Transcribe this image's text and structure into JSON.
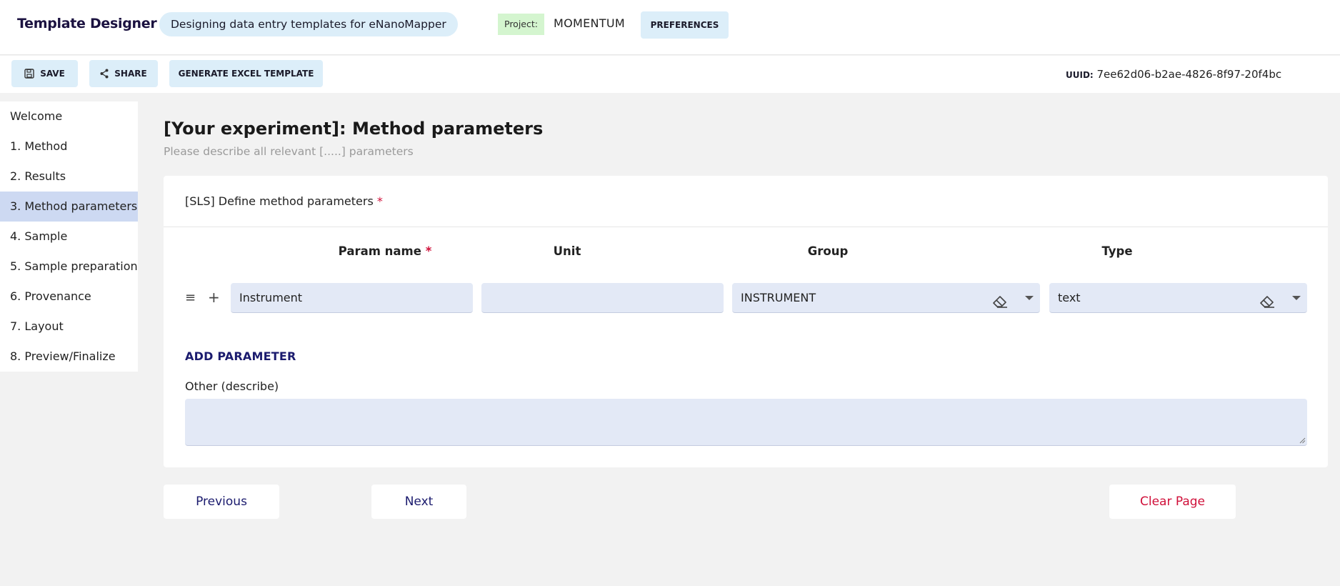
{
  "header": {
    "app_title": "Template Designer",
    "subtitle": "Designing data entry templates for eNanoMapper",
    "project_label": "Project:",
    "project_name": "MOMENTUM",
    "preferences_label": "PREFERENCES"
  },
  "toolbar": {
    "save_label": "SAVE",
    "share_label": "SHARE",
    "generate_label": "GENERATE EXCEL TEMPLATE",
    "uuid_key": "UUID:",
    "uuid_value": "7ee62d06-b2ae-4826-8f97-20f4bc"
  },
  "sidebar": {
    "items": [
      {
        "label": "Welcome"
      },
      {
        "label": "1. Method"
      },
      {
        "label": "2. Results"
      },
      {
        "label": "3. Method parameters",
        "active": true
      },
      {
        "label": "4. Sample"
      },
      {
        "label": "5. Sample preparation"
      },
      {
        "label": "6. Provenance"
      },
      {
        "label": "7. Layout"
      },
      {
        "label": "8. Preview/Finalize"
      }
    ]
  },
  "main": {
    "title": "[Your experiment]: Method parameters",
    "description": "Please describe all relevant [.....] parameters",
    "card_title": "[SLS] Define method parameters",
    "required_mark": "*",
    "columns": {
      "param_name": "Param name",
      "unit": "Unit",
      "group": "Group",
      "type": "Type"
    },
    "row": {
      "param_name": "Instrument",
      "unit": "",
      "group": "INSTRUMENT",
      "type": "text"
    },
    "add_parameter": "ADD PARAMETER",
    "other_label": "Other (describe)",
    "other_value": ""
  },
  "nav": {
    "previous": "Previous",
    "next": "Next",
    "clear": "Clear Page"
  },
  "colors": {
    "accent_light_blue": "#dceef9",
    "sidebar_active": "#cdd9f2",
    "field_bg": "#e3e9f6",
    "nav_blue": "#1b1b6e",
    "danger_red": "#d0103a",
    "project_green": "#d4f5cf"
  },
  "icons": {
    "save": "floppy-disk-icon",
    "share": "share-icon",
    "drag": "drag-handle-icon",
    "add": "plus-icon",
    "clear": "eraser-icon",
    "dropdown": "caret-down-icon"
  }
}
